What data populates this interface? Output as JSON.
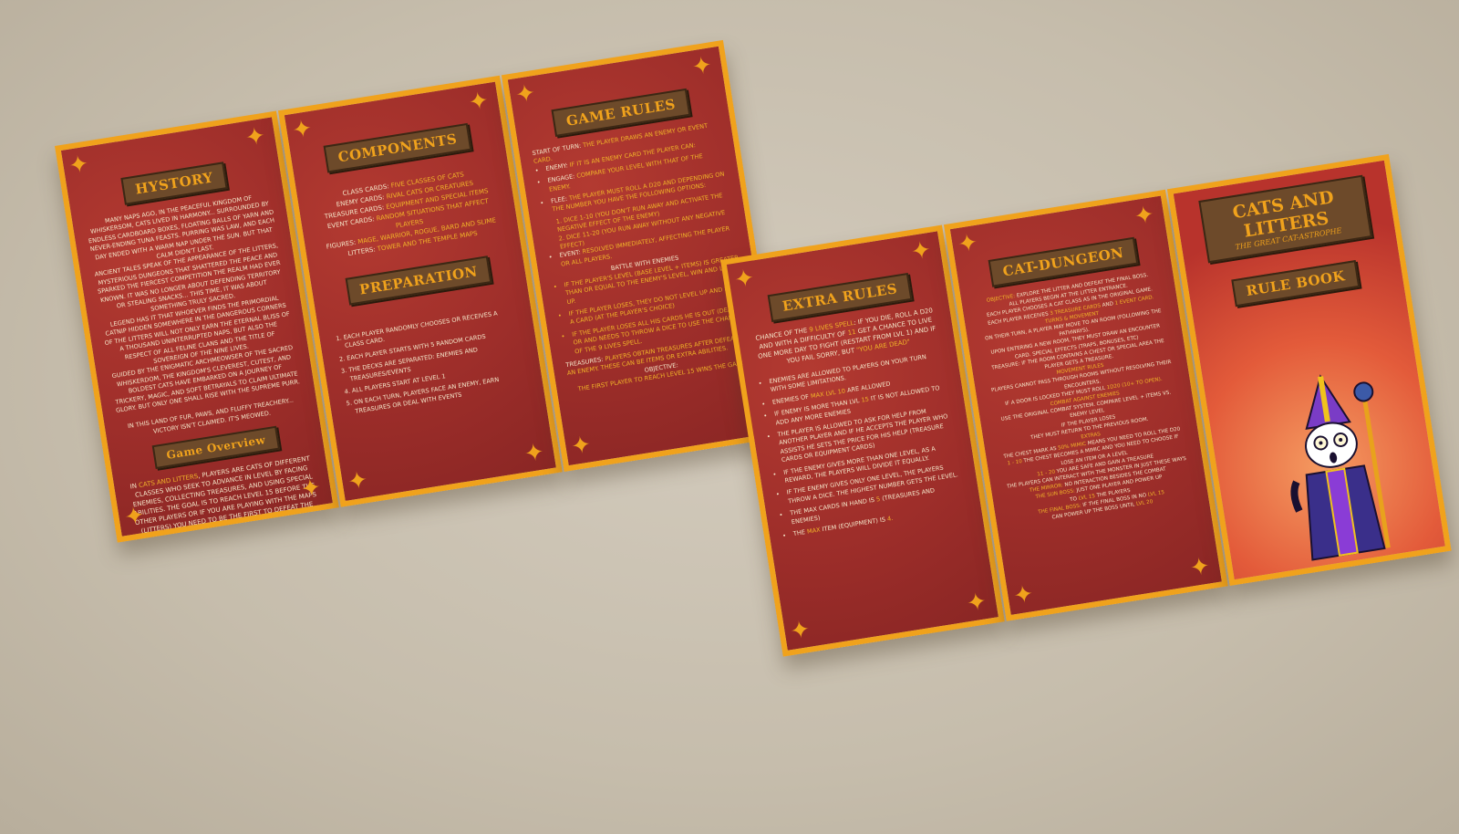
{
  "left_brochure": {
    "history": {
      "title": "HYSTORY",
      "p1": "MANY NAPS AGO, IN THE PEACEFUL KINGDOM OF WHISKERSOM, CATS LIVED IN HARMONY... SURROUNDED BY ENDLESS CARDBOARD BOXES, FLOATING BALLS OF YARN AND NEVER-ENDING TUNA FEASTS. PURRING WAS LAW, AND EACH DAY ENDED WITH A WARM NAP UNDER THE SUN. BUT THAT CALM DIDN'T LAST.",
      "p2": "ANCIENT TALES SPEAK OF THE APPEARANCE OF THE LITTERS, MYSTERIOUS DUNGEONS THAT SHATTERED THE PEACE AND SPARKED THE FIERCEST COMPETITION THE REALM HAD EVER KNOWN. IT WAS NO LONGER ABOUT DEFENDING TERRITORY OR STEALING SNACKS... THIS TIME, IT WAS ABOUT SOMETHING TRULY SACRED.",
      "p3": "LEGEND HAS IT THAT WHOEVER FINDS THE PRIMORDIAL CATNIP HIDDEN SOMEWHERE IN THE DANGEROUS CORNERS OF THE LITTERS WILL NOT ONLY EARN THE ETERNAL BLISS OF A THOUSAND UNINTERRUPTED NAPS, BUT ALSO THE RESPECT OF ALL FELINE CLANS AND THE TITLE OF SOVEREIGN OF THE NINE LIVES.",
      "p4": "GUIDED BY THE ENIGMATIC ARCHMEOWSER OF THE SACRED WHISKERDOM, THE KINGDOM'S CLEVEREST, CUTEST, AND BOLDEST CATS HAVE EMBARKED ON A JOURNEY OF TRICKERY, MAGIC, AND SOFT BETRAYALS TO CLAIM ULTIMATE GLORY. BUT ONLY ONE SHALL RISE WITH THE SUPREME PURR.",
      "p5": "IN THIS LAND OF FUR, PAWS, AND FLUFFY TREACHERY... VICTORY ISN'T CLAIMED. IT'S MEOWED."
    },
    "overview": {
      "title": "Game Overview",
      "text_a": "IN ",
      "text_hl1": "CATS AND LITTERS",
      "text_b": ", PLAYERS ARE CATS OF DIFFERENT CLASSES WHO SEEK TO ADVANCE IN LEVEL BY FACING ENEMIES, COLLECTING TREASURES, AND USING SPECIAL ABILITIES. THE GOAL IS TO REACH LEVEL 15 BEFORE THE OTHER PLAYERS OR IF YOU ARE PLAYING WITH THE MAPS (LITTERS) YOU NEED TO BE THE FIRST TO DEFEAT THE ",
      "text_hl2": "FINAL BOSS."
    },
    "components": {
      "title": "COMPONENTS",
      "items": [
        {
          "label": "CLASS CARDS: ",
          "value": "FIVE CLASSES OF CATS"
        },
        {
          "label": "ENEMY CARDS: ",
          "value": "RIVAL CATS OR CREATURES"
        },
        {
          "label": "TREASURE CARDS: ",
          "value": "EQUIPMENT AND SPECIAL ITEMS"
        },
        {
          "label": "EVENT CARDS: ",
          "value": "RANDOM SITUATIONS THAT AFFECT PLAYERS"
        },
        {
          "label": "FIGURES: ",
          "value": "MAGE, WARRIOR, ROGUE, BARD AND SLIME"
        },
        {
          "label": "LITTERS: ",
          "value": "TOWER AND THE TEMPLE MAPS"
        }
      ]
    },
    "preparation": {
      "title": "PREPARATION",
      "steps": [
        "EACH PLAYER RANDOMLY CHOOSES OR RECEIVES A CLASS CARD.",
        "EACH PLAYER STARTS WITH 5 RANDOM CARDS",
        "THE DECKS ARE SEPARATED: ENEMIES AND TREASURES/EVENTS",
        "ALL PLAYERS START AT LEVEL 1",
        "ON EACH TURN, PLAYERS FACE AN ENEMY, EARN TREASURES OR DEAL WITH EVENTS"
      ]
    },
    "game_rules": {
      "title": "GAME RULES",
      "start_label": "START OF TURN: ",
      "start_value": "THE PLAYER DRAWS AN ENEMY OR EVENT CARD.",
      "enemy_label": "ENEMY: ",
      "enemy_value": "IF IT IS AN ENEMY CARD THE PLAYER CAN:",
      "engage_label": "ENGAGE: ",
      "engage_value": "COMPARE YOUR LEVEL WITH THAT OF THE ENEMY.",
      "flee_label": "FLEE: ",
      "flee_value": "THE PLAYER MUST ROLL A D20 AND DEPENDING ON THE NUMBER YOU HAVE THE FOLLOWING OPTIONS:",
      "dice1": "1. DICE 1-10 (YOU DON'T RUN AWAY AND ACTIVATE THE NEGATIVE EFFECT OF THE ENEMY)",
      "dice2": "2. DICE 11-20 (YOU RUN AWAY WITHOUT ANY NEGATIVE EFFECT)",
      "event_label": "EVENT: ",
      "event_value": "RESOLVED IMMEDIATELY, AFFECTING THE PLAYER OR ALL PLAYERS.",
      "battle_heading": "BATTLE WITH ENEMIES",
      "battle1": "IF THE PLAYER'S LEVEL (BASE LEVEL + ITEMS) IS GREATER THAN OR EQUAL TO THE ENEMY'S LEVEL, WIN AND LEVEL UP.",
      "battle2": "IF THE PLAYER LOSES, THEY DO NOT LEVEL UP AND LOSE A CARD (AT THE PLAYER'S CHOICE)",
      "battle3": "IF THE PLAYER LOSES ALL HIS CARDS HE IS OUT (DEAD) OR AND NEEDS TO THROW A DICE TO USE THE CHANCE OF THE 9 LIVES SPELL.",
      "treasures_label": "TREASURES: ",
      "treasures_value": "PLAYERS OBTAIN TREASURES AFTER DEFEATING AN ENEMY. THESE CAN BE ITEMS OR EXTRA ABILITIES.",
      "objective_heading": "OBJECTIVE:",
      "objective_value": "THE FIRST PLAYER TO REACH LEVEL 15 WINS THE GAME."
    }
  },
  "right_brochure": {
    "extra_rules": {
      "title": "EXTRA RULES",
      "r1_a": "CHANCE OF THE ",
      "r1_hl1": "9 LIVES SPELL",
      "r1_b": ": IF YOU DIE, ROLL A D20 AND WITH A DIFFICULTY OF ",
      "r1_hl2": "11",
      "r1_c": " GET A CHANCE TO LIVE ONE MORE DAY TO FIGHT (RESTART FROM LVL 1) AND IF YOU FAIL SORRY, BUT ",
      "r1_hl3": "\"YOU ARE DEAD\"",
      "r2": "ENEMIES ARE ALLOWED TO PLAYERS ON YOUR TURN WITH SOME LIMITATIONS.",
      "r3_a": "ENEMIES OF ",
      "r3_hl": "MAX LVL 10",
      "r3_b": " ARE ALLOWED",
      "r4_a": "IF ENEMY IS MORE THAN LVL ",
      "r4_hl": "15",
      "r4_b": " IT IS NOT ALLOWED TO ADD ANY MORE ENEMIES",
      "r5": "THE PLAYER IS ALLOWED TO ASK FOR HELP FROM ANOTHER PLAYER AND IF HE ACCEPTS THE PLAYER WHO ASSISTS HE SETS THE PRICE FOR HIS HELP (TREASURE CARDS OR EQUIPMENT CARDS)",
      "r6": "IF THE ENEMY GIVES MORE THAN ONE LEVEL, AS A REWARD, THE PLAYERS WILL DIVIDE IT EQUALLY.",
      "r7": "IF THE ENEMY GIVES ONLY ONE LEVEL, THE PLAYERS THROW A DICE. THE HIGHEST NUMBER GETS THE LEVEL.",
      "r8_a": "THE MAX CARDS IN HAND IS ",
      "r8_hl": "5",
      "r8_b": " (TREASURES AND ENEMIES)",
      "r9_a": "THE ",
      "r9_hl": "MAX",
      "r9_b": " ITEM (EQUIPMENT) IS ",
      "r9_hl2": "4."
    },
    "cat_dungeon": {
      "title": "CAT-DUNGEON",
      "objective_label": "OBJECTIVE: ",
      "objective_value": "EXPLORE THE LITTER AND DEFEAT THE FINAL BOSS.",
      "l1": "ALL PLAYERS BEGIN AT THE LITTER ENTRANCE.",
      "l2_a": "EACH PLAYER CHOOSES A CAT CLASS AS IN THE ORIGINAL GAME.",
      "l3_a": "EACH PLAYER RECEIVES ",
      "l3_hl1": "3 TREASURE CARDS",
      "l3_b": " AND ",
      "l3_hl2": "1 EVENT CARD.",
      "turns_heading": "TURNS & MOVEMENT",
      "l4": "ON THEIR TURN, A PLAYER MAY MOVE TO AN ROOM (FOLLOWING THE PATHWAYS).",
      "l5": "UPON ENTERING A NEW ROOM, THEY MUST DRAW AN ENCOUNTER CARD. SPECIAL EFFECTS (TRAPS, BONUSES, ETC)",
      "l6": "TREASURE: IF THE ROOM CONTAINS A CHEST OR SPECIAL AREA THE PLAYER GETS A TREASURE.",
      "movement_heading": "MOVEMENT RULES",
      "l7": "PLAYERS CANNOT PASS THROUGH ROOMS WITHOUT RESOLVING THEIR ENCOUNTERS.",
      "l8_a": "IF A DOOR IS LOCKED THEY MUST ROLL ",
      "l8_hl": "1D20 (10+ TO OPEN).",
      "combat_heading": "COMBAT AGAINST ENEMIES",
      "l9": "USE THE ORIGINAL COMBAT SYSTEM. COMPARE LEVEL + ITEMS VS. ENEMY LEVEL",
      "l10": "IF THE PLAYER LOSES",
      "l11": "THEY MUST RETURN TO THE PREVIOUS ROOM.",
      "extras_heading": "EXTRAS",
      "l12_a": "THE CHEST MARK AS ",
      "l12_hl": "50% MIMIC",
      "l12_b": " MEANS YOU NEED TO ROLL THE D20",
      "l13_a": "1 - 10",
      "l13_b": " THE CHEST BECOMES A MIMIC AND YOU NEED TO CHOOSE IF LOSE AN ITEM OR A LEVEL",
      "l14_a": "11 - 20",
      "l14_b": " YOU ARE SAFE AND GAIN A TREASURE",
      "l15": "THE PLAYERS CAN INTERACT WITH THE MONSTER IN JUST THESE WAYS",
      "l16_hl": "THE MIRROR:",
      "l16_b": " NO INTERACTION BESIDES THE COMBAT",
      "l17_hl": "THE SUN BOSS:",
      "l17_b": " JUST ONE PLAYER AND POWER UP",
      "l18_a": "TO ",
      "l18_hl": "LVL 15",
      "l18_b": " THE PLAYERS",
      "l19_hl": "THE FINAL BOSS:",
      "l19_b": " IF THE FINAL BOSS IN NO ",
      "l19_hl2": "LVL 15",
      "l20_a": "CAN POWER UP THE BOSS UNTIL ",
      "l20_hl": "LVL 20"
    },
    "cover": {
      "title": "CATS AND LITTERS",
      "subtitle": "THE GREAT CAT-ASTROPHE",
      "label": "RULE BOOK"
    }
  },
  "colors": {
    "panel_red": "#9e2e2a",
    "accent_gold": "#f0a21c",
    "sign_brown": "#6d4a2a",
    "cover_glow": "#f59b61",
    "background": "#c6bdac"
  },
  "icons": [
    "star-icon",
    "cat-bishop-illustration"
  ]
}
